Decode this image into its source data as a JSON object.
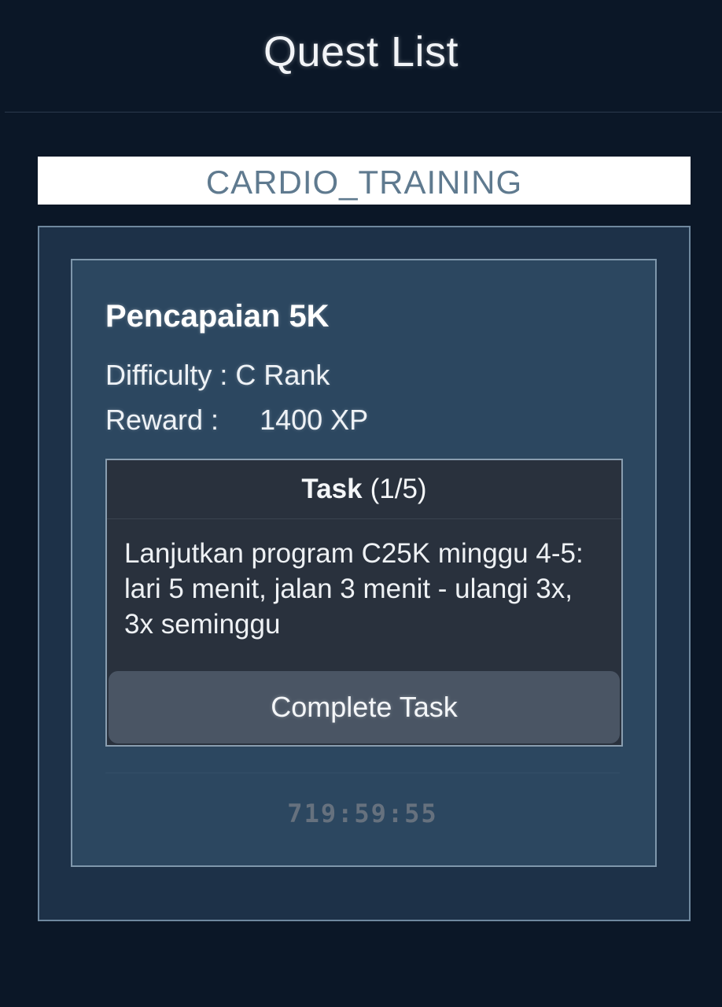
{
  "header": {
    "title": "Quest List"
  },
  "category": {
    "label": "CARDIO_TRAINING"
  },
  "quest": {
    "title": "Pencapaian 5K",
    "difficulty": "Difficulty : C Rank",
    "reward_label": "Reward :",
    "reward_value": "1400 XP",
    "task": {
      "label": "Task",
      "progress": "(1/5)",
      "description": "Lanjutkan program C25K minggu 4-5: lari 5 menit, jalan 3 menit - ulangi 3x, 3x seminggu",
      "complete_button": "Complete Task"
    },
    "timer": "719:59:55"
  },
  "colors": {
    "background": "#0b1727",
    "outer_panel": "#1d3148",
    "quest_card": "#2c4760",
    "task_box": "#29313d",
    "button": "#4a5564",
    "category_text": "#5f7a8f"
  }
}
